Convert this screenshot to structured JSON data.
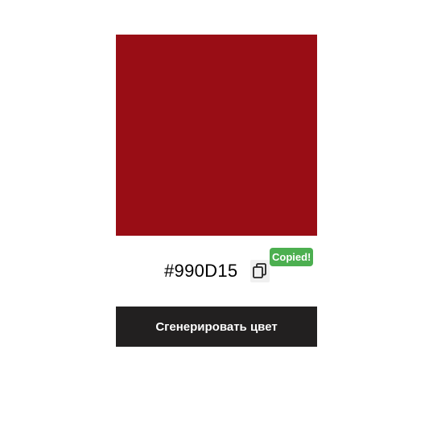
{
  "color": {
    "hex": "#990D15",
    "swatch_color": "#990d15"
  },
  "copy": {
    "icon": "copy-icon",
    "tooltip_text": "Copied!",
    "tooltip_color": "#4caf50"
  },
  "actions": {
    "generate_label": "Сгенерировать цвет"
  }
}
